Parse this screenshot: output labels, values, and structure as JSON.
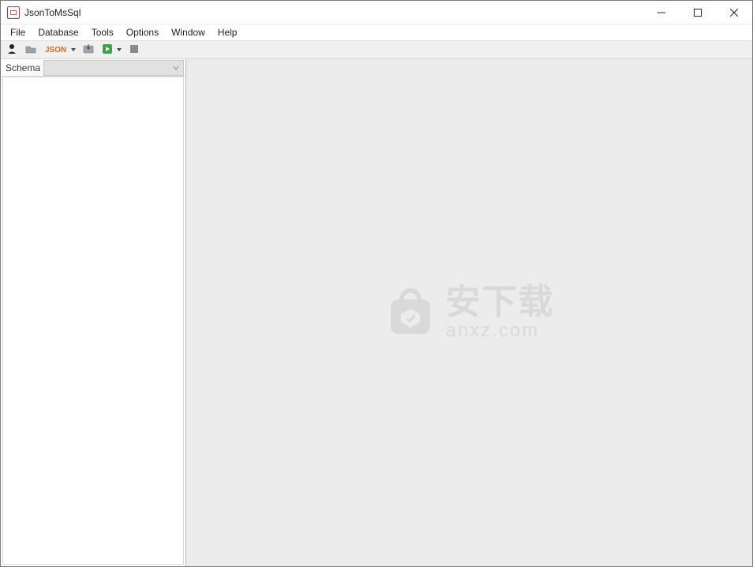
{
  "window": {
    "title": "JsonToMsSql"
  },
  "menu": {
    "items": [
      "File",
      "Database",
      "Tools",
      "Options",
      "Window",
      "Help"
    ]
  },
  "toolbar": {
    "json_label": "JSON"
  },
  "sidebar": {
    "schema_label": "Schema",
    "schema_value": ""
  },
  "watermark": {
    "line1": "安下载",
    "line2": "anxz.com"
  }
}
